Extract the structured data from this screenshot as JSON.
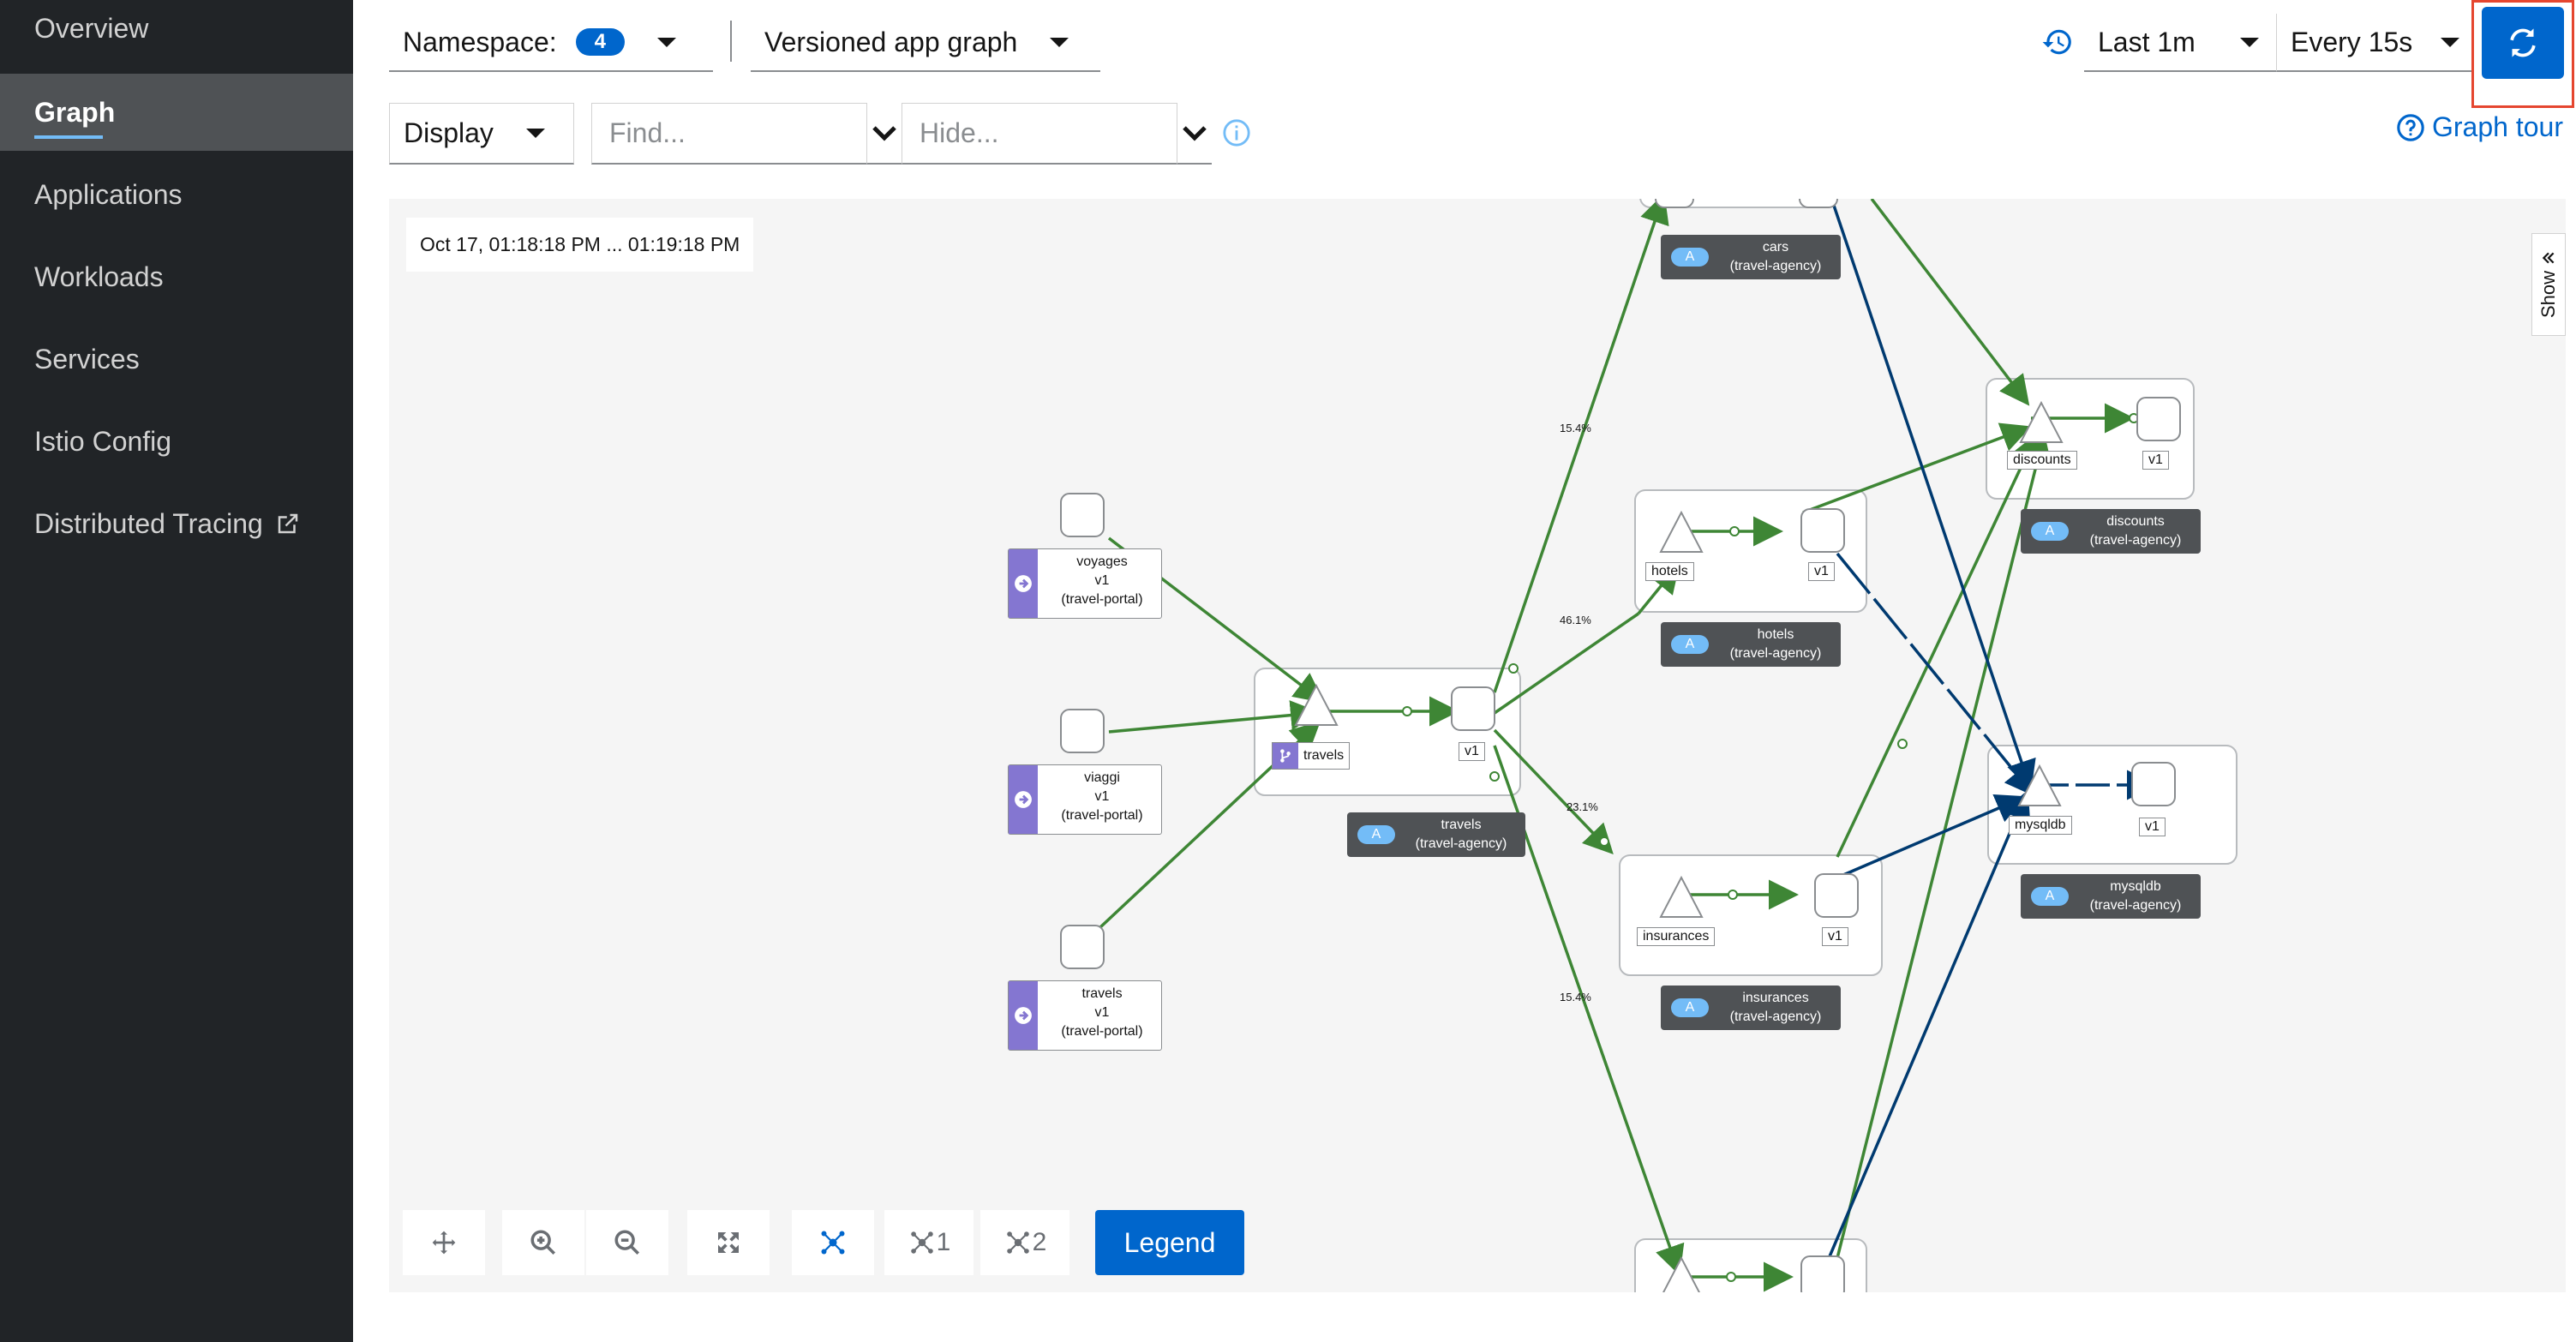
{
  "sidebar": {
    "items": [
      {
        "label": "Overview"
      },
      {
        "label": "Graph"
      },
      {
        "label": "Applications"
      },
      {
        "label": "Workloads"
      },
      {
        "label": "Services"
      },
      {
        "label": "Istio Config"
      },
      {
        "label": "Distributed Tracing"
      }
    ]
  },
  "toolbar": {
    "namespace_label": "Namespace:",
    "namespace_count": "4",
    "graph_type": "Versioned app graph",
    "time_range": "Last 1m",
    "refresh_interval": "Every 15s",
    "display_label": "Display",
    "find_placeholder": "Find...",
    "hide_placeholder": "Hide...",
    "graph_tour": "Graph tour"
  },
  "graph": {
    "timestamp": "Oct 17, 01:18:18 PM ... 01:19:18 PM",
    "show_tab": "Show",
    "nodes": {
      "voyages": {
        "name": "voyages",
        "version": "v1",
        "ns": "(travel-portal)"
      },
      "viaggi": {
        "name": "viaggi",
        "version": "v1",
        "ns": "(travel-portal)"
      },
      "travels_portal": {
        "name": "travels",
        "version": "v1",
        "ns": "(travel-portal)"
      },
      "travels_svc": "travels",
      "travels_v1": "v1",
      "travels_app": {
        "name": "travels",
        "ns": "(travel-agency)"
      },
      "cars_app": {
        "name": "cars",
        "ns": "(travel-agency)"
      },
      "hotels_svc": "hotels",
      "hotels_v1": "v1",
      "hotels_app": {
        "name": "hotels",
        "ns": "(travel-agency)"
      },
      "discounts_svc": "discounts",
      "discounts_v1": "v1",
      "discounts_app": {
        "name": "discounts",
        "ns": "(travel-agency)"
      },
      "mysqldb_svc": "mysqldb",
      "mysqldb_v1": "v1",
      "mysqldb_app": {
        "name": "mysqldb",
        "ns": "(travel-agency)"
      },
      "insurances_svc": "insurances",
      "insurances_v1": "v1",
      "insurances_app": {
        "name": "insurances",
        "ns": "(travel-agency)"
      },
      "app_badge": "A"
    },
    "edges": {
      "to_cars": "15.4%",
      "to_hotels": "46.1%",
      "to_insurances": "23.1%",
      "to_bottom": "15.4%"
    },
    "colors": {
      "healthy_edge": "#3e8635",
      "tcp_edge": "#003a70",
      "app_box": "#4f5255",
      "portal_badge": "#8476d1"
    }
  },
  "controls": {
    "ns_layout1": "1",
    "ns_layout2": "2",
    "legend": "Legend"
  }
}
